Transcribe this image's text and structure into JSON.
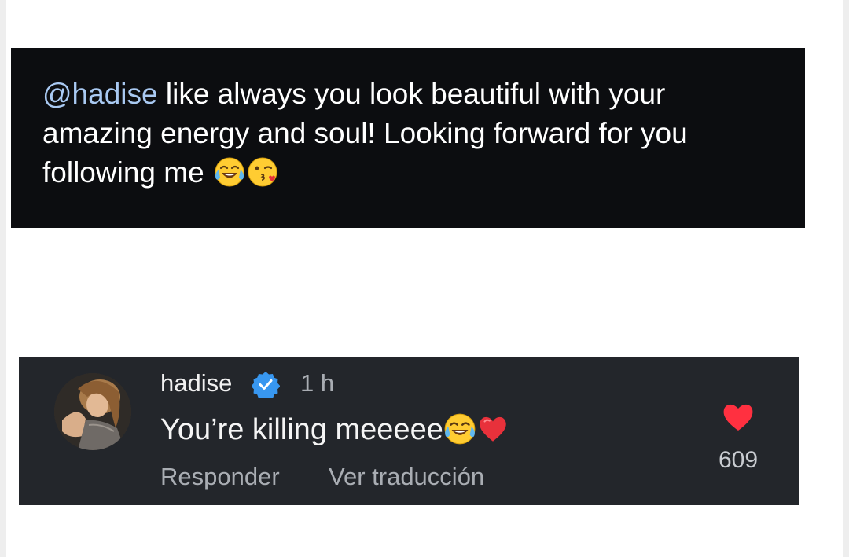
{
  "comment": {
    "mention": "@hadise",
    "text": " like always you look beautiful with your amazing energy and soul! Looking forward for you following me",
    "emojis": [
      "tears-of-joy-emoji",
      "kissing-face-emoji"
    ]
  },
  "reply": {
    "username": "hadise",
    "verified": true,
    "time": "1 h",
    "text": "You’re killing meeeee",
    "emojis": [
      "tears-of-joy-emoji",
      "red-heart-emoji"
    ],
    "actions": {
      "respond": "Responder",
      "translate": "Ver traducción"
    },
    "likes": "609",
    "liked": true
  },
  "colors": {
    "comment_bg": "#0c0d10",
    "reply_bg": "#23262b",
    "mention": "#a9c9f2",
    "verified_blue": "#3897f0",
    "heart_red": "#ff3040"
  }
}
